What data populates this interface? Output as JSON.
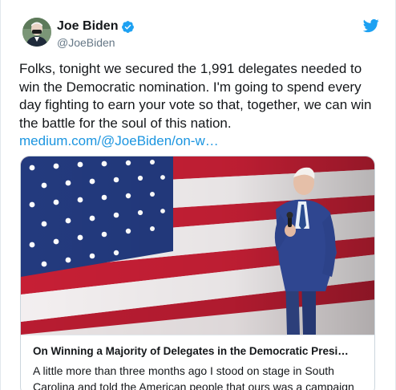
{
  "author": {
    "display_name": "Joe Biden",
    "handle": "@JoeBiden"
  },
  "tweet": {
    "text": "Folks, tonight we secured the 1,991 delegates needed to win the Democratic nomination. I'm going to spend every day fighting to earn your vote so that, together, we can win the battle for the soul of this nation. ",
    "link": "medium.com/@JoeBiden/on-w…"
  },
  "card": {
    "title": "On Winning a Majority of Delegates in the Democratic Presi…",
    "description": "A little more than three months ago I stood on stage in South Carolina and told the American people that ours was a campaign"
  },
  "icons": {
    "verified": "verified-badge-icon",
    "brand": "twitter-bird-icon"
  },
  "colors": {
    "link": "#1b95e0",
    "verified": "#1da1f2",
    "brand": "#1da1f2",
    "handle": "#657786"
  }
}
